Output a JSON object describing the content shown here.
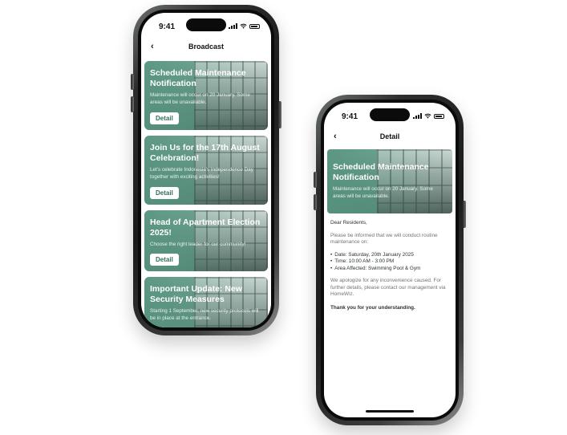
{
  "status": {
    "time": "9:41"
  },
  "broadcast": {
    "title": "Broadcast",
    "detail_label": "Detail",
    "cards": [
      {
        "title": "Scheduled Maintenance Notification",
        "text": "Maintenance will occur on 20 January. Some areas will be unavailable."
      },
      {
        "title": "Join Us for the 17th August Celebration!",
        "text": "Let's celebrate Indonesia's Independence Day together with exciting activities!"
      },
      {
        "title": "Head of Apartment Election 2025!",
        "text": "Choose the right leader for our community!"
      },
      {
        "title": "Important Update: New Security Measures",
        "text": "Starting 1 September, new security protocols will be in place at the entrance."
      }
    ]
  },
  "detail": {
    "title": "Detail",
    "hero_title": "Scheduled Maintenance Notification",
    "hero_text": "Maintenance will occur on 20 January. Some areas will be unavailable.",
    "greeting": "Dear Residents,",
    "intro": "Please be informed that we will conduct routine maintenance on:",
    "bullets": [
      "Date: Saturday, 20th January 2025",
      "Time: 10:00 AM - 3:00 PM",
      "Area Affected: Swimming Pool & Gym"
    ],
    "apology": "We apologize for any inconvenience caused. For further details, please contact our management via HomeWiz.",
    "thanks": "Thank you for your understanding."
  },
  "icons": {
    "back": "chevron-left-icon",
    "signal": "cellular-signal-icon",
    "wifi": "wifi-icon",
    "battery": "battery-icon"
  },
  "colors": {
    "accent": "#569480",
    "button_text": "#2f6f5c",
    "frame": "#1a1b1c"
  }
}
